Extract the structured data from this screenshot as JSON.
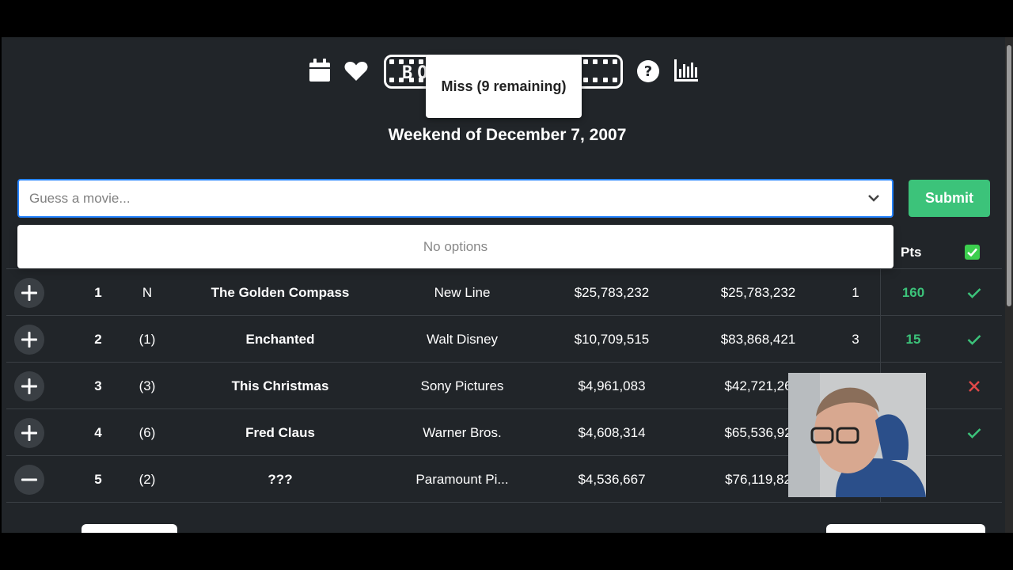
{
  "toast": {
    "message": "Miss (9 remaining)"
  },
  "logo": {
    "text": "BO"
  },
  "header": {
    "weekend_label": "Weekend of December 7, 2007"
  },
  "guess": {
    "placeholder": "Guess a movie...",
    "submit_label": "Submit"
  },
  "dropdown": {
    "empty_text": "No options"
  },
  "table": {
    "headers": {
      "pts": "Pts"
    },
    "rows": [
      {
        "action": "plus",
        "rank": "1",
        "prev": "N",
        "title": "The Golden Compass",
        "distributor": "New Line",
        "weekend_gross": "$25,783,232",
        "total_gross": "$25,783,232",
        "weeks": "1",
        "pts": "160",
        "mark": "check"
      },
      {
        "action": "plus",
        "rank": "2",
        "prev": "(1)",
        "title": "Enchanted",
        "distributor": "Walt Disney",
        "weekend_gross": "$10,709,515",
        "total_gross": "$83,868,421",
        "weeks": "3",
        "pts": "15",
        "mark": "check"
      },
      {
        "action": "plus",
        "rank": "3",
        "prev": "(3)",
        "title": "This Christmas",
        "distributor": "Sony Pictures",
        "weekend_gross": "$4,961,083",
        "total_gross": "$42,721,26",
        "weeks": "",
        "pts": "",
        "mark": "cross"
      },
      {
        "action": "plus",
        "rank": "4",
        "prev": "(6)",
        "title": "Fred Claus",
        "distributor": "Warner Bros.",
        "weekend_gross": "$4,608,314",
        "total_gross": "$65,536,92",
        "weeks": "",
        "pts": "",
        "mark": "check"
      },
      {
        "action": "minus",
        "rank": "5",
        "prev": "(2)",
        "title": "???",
        "distributor": "Paramount Pi...",
        "weekend_gross": "$4,536,667",
        "total_gross": "$76,119,82",
        "weeks": "",
        "pts": "",
        "mark": ""
      }
    ]
  },
  "colors": {
    "background": "#212529",
    "accent_green": "#3cc37a",
    "miss_red": "#e04848",
    "input_border": "#2684ff"
  },
  "icons": [
    "calendar-icon",
    "heart-icon",
    "help-icon",
    "stats-icon",
    "chevron-down-icon",
    "plus-icon",
    "minus-icon",
    "check-icon",
    "cross-icon"
  ]
}
